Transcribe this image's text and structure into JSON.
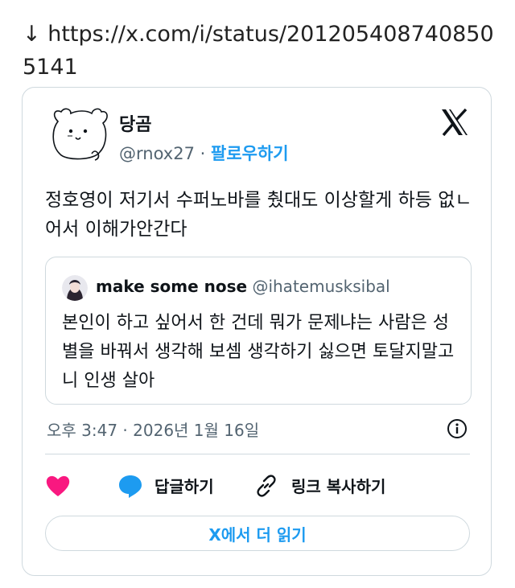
{
  "link": {
    "arrow": "↓",
    "url": "https://x.com/i/status/2012054087408505141"
  },
  "tweet": {
    "author_name": "당곰",
    "author_handle": "@rnox27",
    "separator": "·",
    "follow_label": "팔로우하기",
    "text": "정호영이 저기서 수퍼노바를 췄대도 이상할게 하등 없ㄴ어서 이해가안간다",
    "timestamp": "오후 3:47 · 2026년 1월 16일"
  },
  "quote": {
    "author_name": "make some nose",
    "author_handle": "@ihatemusksibal",
    "text": "본인이 하고 싶어서 한 건데 뭐가 문제냐는 사람은 성별을 바꿔서 생각해 보셈 생각하기 싫으면 토달지말고 니 인생 살아"
  },
  "actions": {
    "reply_label": "답글하기",
    "copy_link_label": "링크 복사하기",
    "read_more_label": "X에서 더 읽기"
  },
  "icons": {
    "like": "heart-icon",
    "reply": "speech-bubble-icon",
    "copy": "link-icon",
    "info": "info-icon",
    "brand": "x-logo-icon"
  },
  "colors": {
    "accent": "#1d9bf0",
    "heart": "#f91880",
    "border": "#cfd9de",
    "muted": "#536471"
  }
}
